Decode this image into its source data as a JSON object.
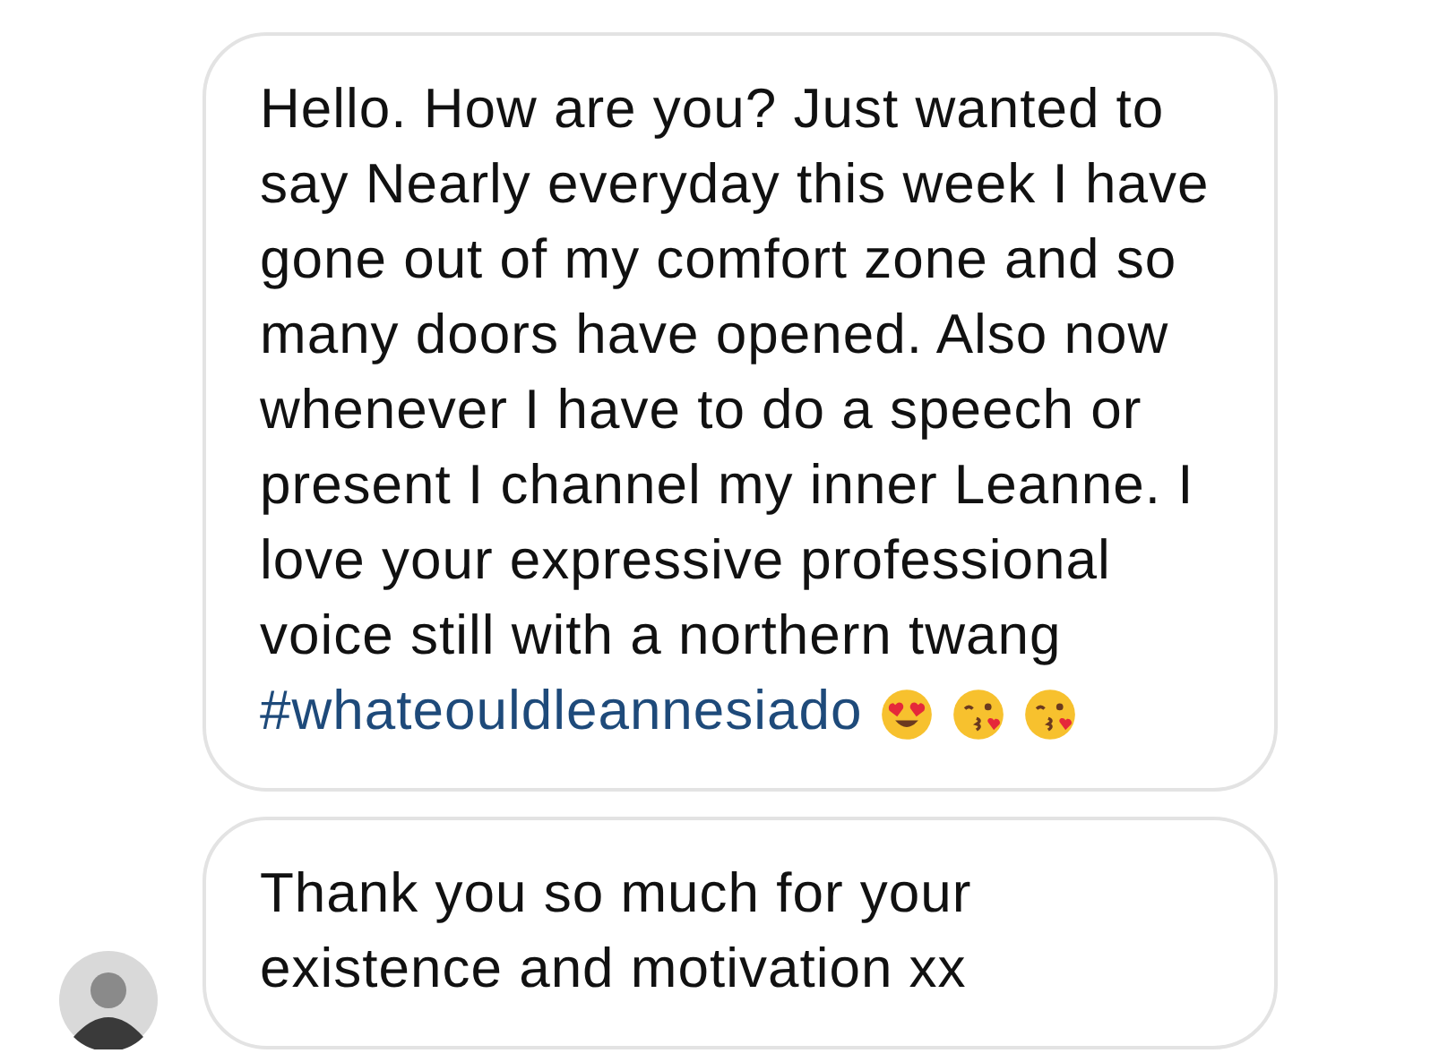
{
  "messages": [
    {
      "text": "Hello. How are you? Just wanted to say Nearly everyday this week I have gone out of my comfort zone and so many doors have opened. Also now whenever I have to do a speech or present I channel my inner Leanne. I love your expressive professional voice still with a northern twang",
      "hashtag": "#whateouldleannesiado",
      "show_avatar": false
    },
    {
      "text": "Thank you so much for your existence and motivation xx",
      "show_avatar": true
    }
  ]
}
